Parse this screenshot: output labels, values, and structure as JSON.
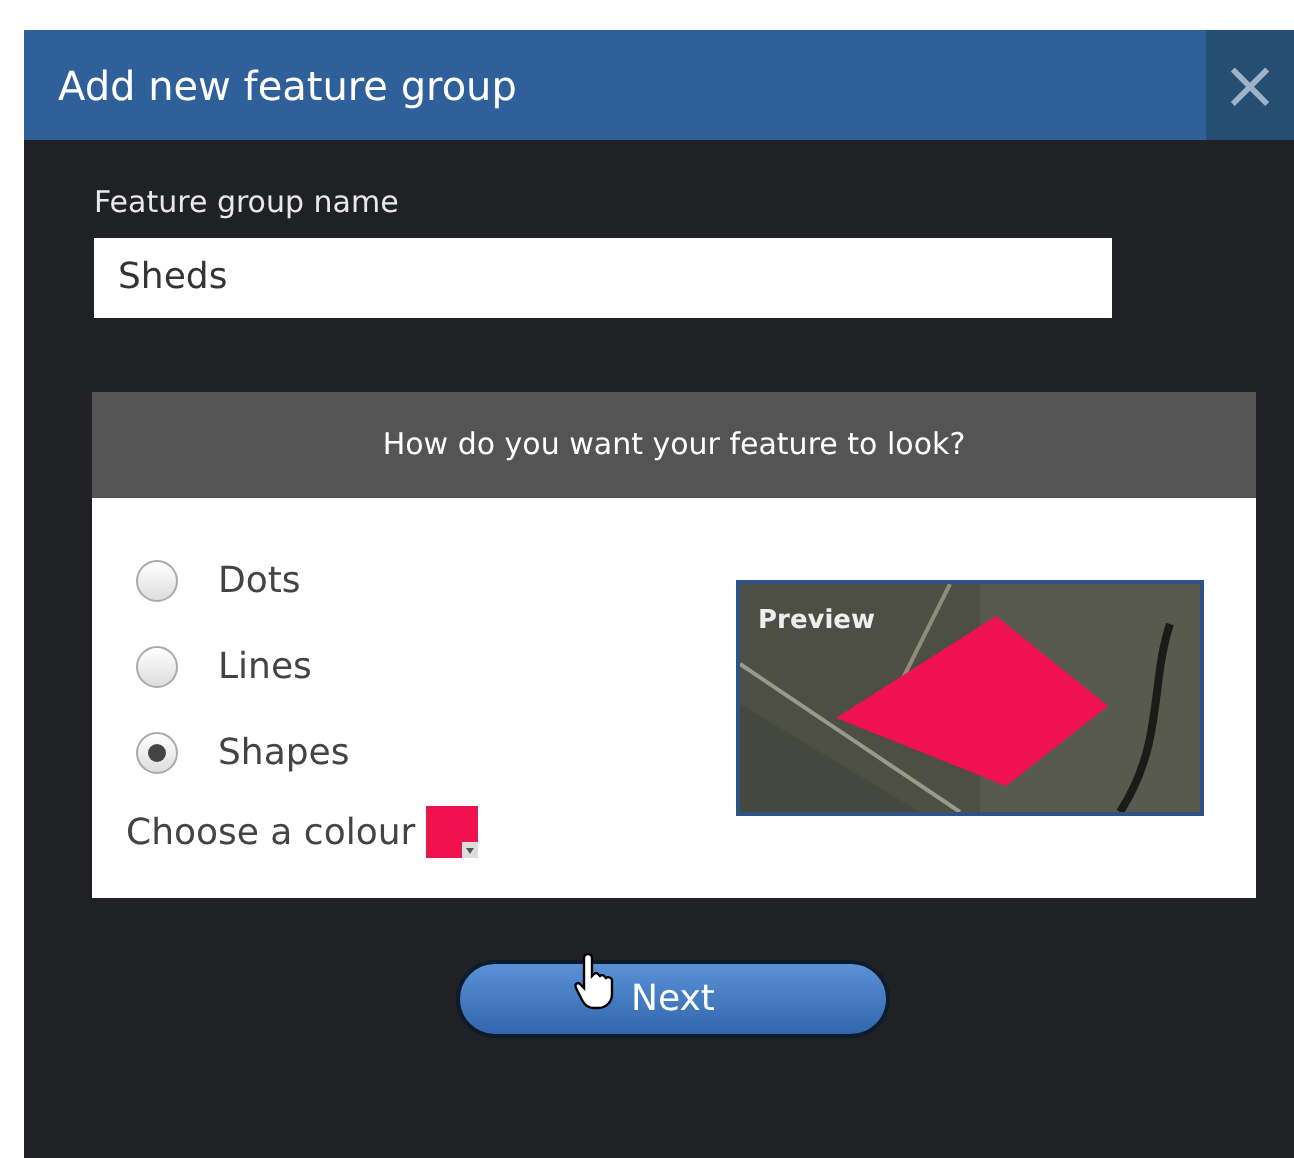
{
  "dialog": {
    "title": "Add new feature group",
    "close": "×"
  },
  "name_field": {
    "label": "Feature group name",
    "value": "Sheds"
  },
  "style_panel": {
    "heading": "How do you want your feature to look?",
    "options": [
      {
        "label": "Dots",
        "selected": false
      },
      {
        "label": "Lines",
        "selected": false
      },
      {
        "label": "Shapes",
        "selected": true
      }
    ],
    "colour_label": "Choose a colour",
    "color": "#f0124f",
    "preview": {
      "label": "Preview",
      "kind": "picture"
    }
  },
  "next_button": "Next"
}
